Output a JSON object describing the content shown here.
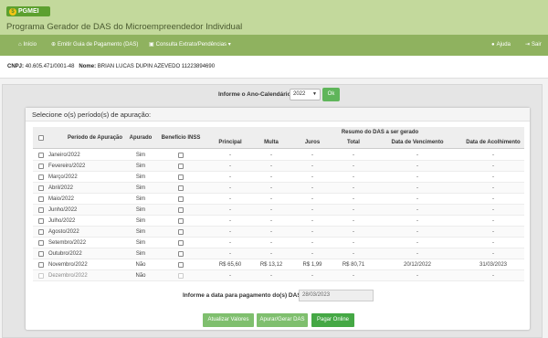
{
  "app": {
    "badge": "PGMEI",
    "title": "Programa Gerador de DAS do Microempreendedor Individual"
  },
  "nav": {
    "inicio": "Início",
    "emitir": "Emitir Guia de Pagamento (DAS)",
    "consulta": "Consulta Extrato/Pendências",
    "ajuda": "Ajuda",
    "sair": "Sair"
  },
  "contribuinte": {
    "cnpj_label": "CNPJ:",
    "cnpj_value": "40.605.471/0001-48",
    "nome_label": "Nome:",
    "nome_value": "BRIAN LUCAS DUPIN AZEVEDO 11223894690"
  },
  "year_selector": {
    "label": "Informe o Ano-Calendário:",
    "selected": "2022",
    "ok_label": "Ok"
  },
  "card": {
    "title": "Selecione o(s) período(s) de apuração:"
  },
  "table": {
    "headers": {
      "periodo": "Período de Apuração",
      "apurado": "Apurado",
      "beneficio": "Benefício INSS",
      "resumo": "Resumo do DAS a ser gerado",
      "principal": "Principal",
      "multa": "Multa",
      "juros": "Juros",
      "total": "Total",
      "vencimento": "Data de Vencimento",
      "acolhimento": "Data de Acolhimento"
    },
    "rows": [
      {
        "periodo": "Janeiro/2022",
        "apurado": "Sim",
        "principal": "-",
        "multa": "-",
        "juros": "-",
        "total": "-",
        "vencimento": "-",
        "acolhimento": "-"
      },
      {
        "periodo": "Fevereiro/2022",
        "apurado": "Sim",
        "principal": "-",
        "multa": "-",
        "juros": "-",
        "total": "-",
        "vencimento": "-",
        "acolhimento": "-"
      },
      {
        "periodo": "Março/2022",
        "apurado": "Sim",
        "principal": "-",
        "multa": "-",
        "juros": "-",
        "total": "-",
        "vencimento": "-",
        "acolhimento": "-"
      },
      {
        "periodo": "Abril/2022",
        "apurado": "Sim",
        "principal": "-",
        "multa": "-",
        "juros": "-",
        "total": "-",
        "vencimento": "-",
        "acolhimento": "-"
      },
      {
        "periodo": "Maio/2022",
        "apurado": "Sim",
        "principal": "-",
        "multa": "-",
        "juros": "-",
        "total": "-",
        "vencimento": "-",
        "acolhimento": "-"
      },
      {
        "periodo": "Junho/2022",
        "apurado": "Sim",
        "principal": "-",
        "multa": "-",
        "juros": "-",
        "total": "-",
        "vencimento": "-",
        "acolhimento": "-"
      },
      {
        "periodo": "Julho/2022",
        "apurado": "Sim",
        "principal": "-",
        "multa": "-",
        "juros": "-",
        "total": "-",
        "vencimento": "-",
        "acolhimento": "-"
      },
      {
        "periodo": "Agosto/2022",
        "apurado": "Sim",
        "principal": "-",
        "multa": "-",
        "juros": "-",
        "total": "-",
        "vencimento": "-",
        "acolhimento": "-"
      },
      {
        "periodo": "Setembro/2022",
        "apurado": "Sim",
        "principal": "-",
        "multa": "-",
        "juros": "-",
        "total": "-",
        "vencimento": "-",
        "acolhimento": "-"
      },
      {
        "periodo": "Outubro/2022",
        "apurado": "Sim",
        "principal": "-",
        "multa": "-",
        "juros": "-",
        "total": "-",
        "vencimento": "-",
        "acolhimento": "-"
      },
      {
        "periodo": "Novembro/2022",
        "apurado": "Não",
        "principal": "R$ 65,60",
        "multa": "R$ 13,12",
        "juros": "R$ 1,99",
        "total": "R$ 80,71",
        "vencimento": "20/12/2022",
        "acolhimento": "31/03/2023"
      },
      {
        "periodo": "Dezembro/2022",
        "apurado": "Não",
        "principal": "-",
        "multa": "-",
        "juros": "-",
        "total": "-",
        "vencimento": "-",
        "acolhimento": "-"
      }
    ]
  },
  "payment": {
    "label": "Informe a data para pagamento do(s) DAS:",
    "value": "28/03/2023"
  },
  "buttons": {
    "atualizar": "Atualizar Valores",
    "apurar": "Apurar/Gerar DAS",
    "pagar": "Pagar Online"
  },
  "colors": {
    "header_bg": "#c3d99c",
    "navbar_bg": "#8fb25f",
    "brand_green": "#5ca02f",
    "button_green": "#45a845"
  }
}
